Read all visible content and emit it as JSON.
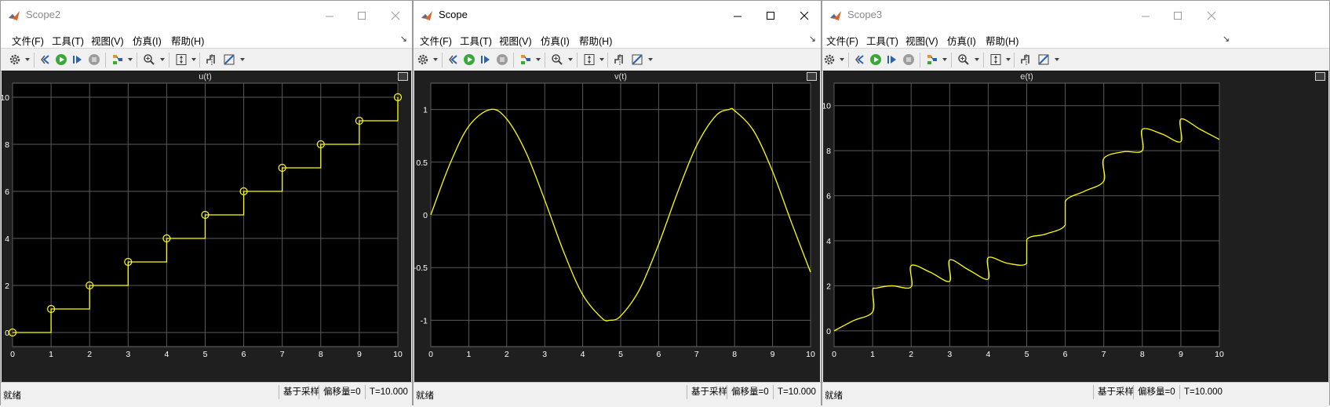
{
  "windows": [
    {
      "title": "Scope2",
      "active": false,
      "menu": [
        "文件(F)",
        "工具(T)",
        "视图(V)",
        "仿真(I)",
        "帮助(H)"
      ],
      "status": {
        "left": "就绪",
        "sample": "基于采样",
        "offset": "偏移量=0",
        "time": "T=10.000"
      }
    },
    {
      "title": "Scope",
      "active": true,
      "menu": [
        "文件(F)",
        "工具(T)",
        "视图(V)",
        "仿真(I)",
        "帮助(H)"
      ],
      "status": {
        "left": "就绪",
        "sample": "基于采样",
        "offset": "偏移量=0",
        "time": "T=10.000"
      }
    },
    {
      "title": "Scope3",
      "active": false,
      "menu": [
        "文件(F)",
        "工具(T)",
        "视图(V)",
        "仿真(I)",
        "帮助(H)"
      ],
      "status": {
        "left": "就绪",
        "sample": "基于采样",
        "offset": "偏移量=0",
        "time": "T=10.000"
      }
    }
  ],
  "colors": {
    "trace": "#ffff00",
    "axes_bg": "#000000",
    "plot_bg": "#1f1f1f",
    "grid": "#5a5a5a",
    "tick_text": "#ffffff",
    "title_text": "#dcdcdc"
  },
  "icons": [
    "settings-gear-icon",
    "restore-icon",
    "run-icon",
    "step-forward-icon",
    "stop-icon",
    "signal-style-icon",
    "zoom-in-icon",
    "scale-axes-icon",
    "triggers-icon",
    "measure-icon"
  ],
  "chart_data": [
    {
      "type": "line",
      "title": "u(t)",
      "style": "stairs with circle markers",
      "xlim": [
        0,
        10
      ],
      "ylim": [
        -0.6,
        10.6
      ],
      "xticks": [
        0,
        1,
        2,
        3,
        4,
        5,
        6,
        7,
        8,
        9,
        10
      ],
      "yticks": [
        0,
        2,
        4,
        6,
        8,
        10
      ],
      "grid": true,
      "x": [
        0,
        1,
        2,
        3,
        4,
        5,
        6,
        7,
        8,
        9,
        10
      ],
      "y": [
        0,
        1,
        2,
        3,
        4,
        5,
        6,
        7,
        8,
        9,
        10
      ]
    },
    {
      "type": "line",
      "title": "v(t)",
      "function": "sin(t)",
      "xlim": [
        0,
        10
      ],
      "ylim": [
        -1.25,
        1.25
      ],
      "xticks": [
        0,
        1,
        2,
        3,
        4,
        5,
        6,
        7,
        8,
        9,
        10
      ],
      "yticks": [
        -1,
        -0.5,
        0,
        0.5,
        1
      ],
      "grid": true,
      "x": [
        0,
        0.5,
        1,
        1.5708,
        2,
        2.5,
        3,
        3.5,
        4,
        4.5,
        4.7124,
        5,
        5.5,
        6,
        6.5,
        7,
        7.5,
        7.854,
        8,
        8.5,
        9,
        9.5,
        10
      ],
      "y": [
        0,
        0.479,
        0.841,
        1,
        0.909,
        0.598,
        0.141,
        -0.351,
        -0.757,
        -0.978,
        -1,
        -0.959,
        -0.706,
        -0.279,
        0.215,
        0.657,
        0.938,
        1,
        0.989,
        0.798,
        0.412,
        -0.075,
        -0.544
      ]
    },
    {
      "type": "line",
      "title": "e(t)",
      "xlim": [
        0,
        10
      ],
      "ylim": [
        -0.7,
        11
      ],
      "xticks": [
        0,
        1,
        2,
        3,
        4,
        5,
        6,
        7,
        8,
        9,
        10
      ],
      "yticks": [
        0,
        2,
        4,
        6,
        8,
        10
      ],
      "grid": true,
      "x": [
        0,
        0.5,
        0.999,
        1,
        1.1,
        1.5,
        1.999,
        2,
        2.5,
        2.999,
        3,
        3.5,
        3.999,
        4,
        4.5,
        4.999,
        5,
        5.5,
        5.999,
        6,
        6.5,
        6.999,
        7,
        7.5,
        7.999,
        8,
        8.5,
        8.999,
        9,
        9.5,
        10
      ],
      "y": [
        0,
        0.45,
        0.84,
        1.8,
        1.9,
        2.0,
        1.95,
        2.9,
        2.6,
        2.2,
        3.15,
        2.7,
        2.3,
        3.25,
        3.0,
        3.0,
        4.05,
        4.3,
        4.7,
        5.75,
        6.2,
        6.65,
        7.65,
        7.95,
        8.0,
        8.95,
        8.75,
        8.4,
        9.4,
        8.95,
        8.5
      ]
    }
  ]
}
